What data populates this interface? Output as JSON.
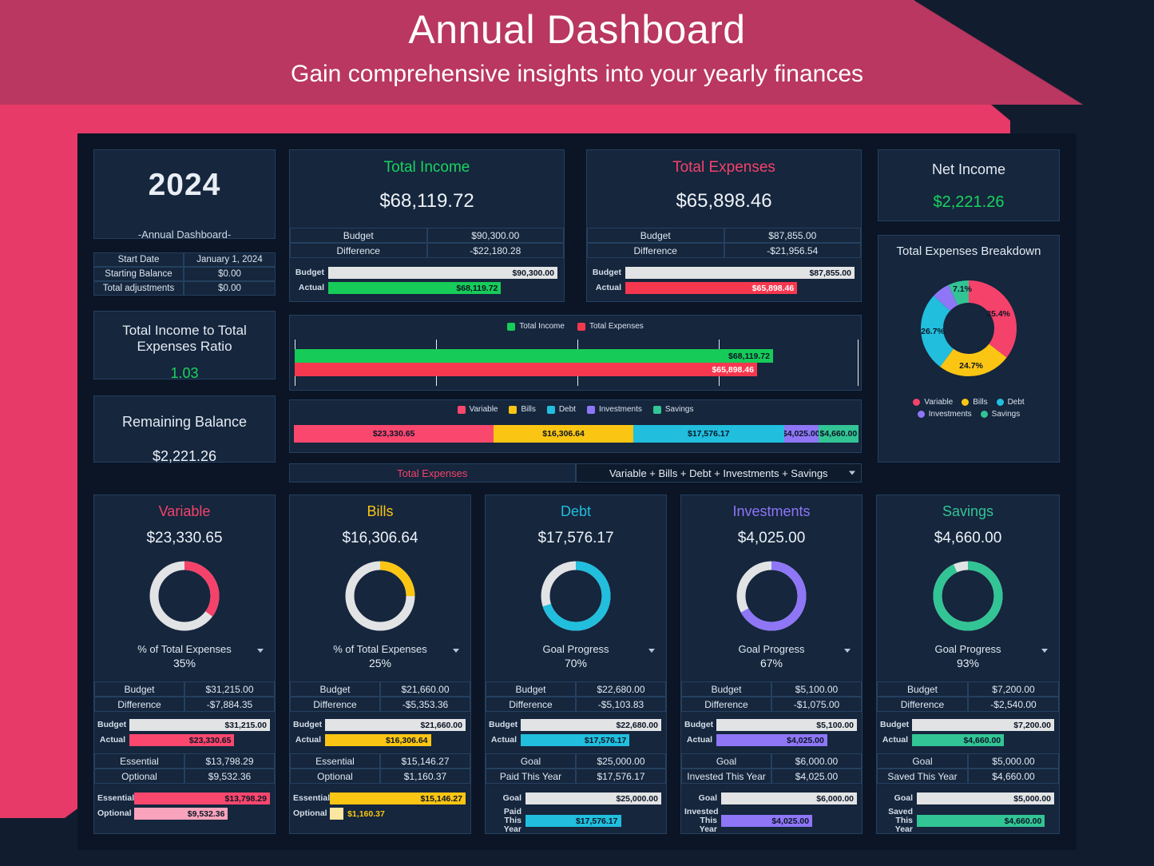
{
  "header": {
    "title": "Annual Dashboard",
    "subtitle": "Gain comprehensive insights into your yearly finances",
    "banner_color": "#b93760",
    "page_accent": "#e73a68"
  },
  "year_panel": {
    "year": "2024",
    "caption": "-Annual Dashboard-",
    "info_rows": [
      {
        "label": "Start Date",
        "value": "January 1, 2024"
      },
      {
        "label": "Starting Balance",
        "value": "$0.00"
      },
      {
        "label": "Total adjustments",
        "value": "$0.00"
      }
    ]
  },
  "ratio_panel": {
    "title_line1": "Total Income to Total",
    "title_line2": "Expenses Ratio",
    "value": "1.03",
    "value_color": "#19d45d"
  },
  "remaining_panel": {
    "title": "Remaining Balance",
    "value": "$2,221.26"
  },
  "total_income": {
    "title": "Total Income",
    "title_color": "#19d45d",
    "amount": "$68,119.72",
    "rows": [
      {
        "label": "Budget",
        "value": "$90,300.00",
        "color": "#e2e9f2"
      },
      {
        "label": "Difference",
        "value": "-$22,180.28",
        "color": "#f5426a"
      }
    ],
    "bars": [
      {
        "label": "Budget",
        "value": "$90,300.00",
        "pct": 100,
        "color": "#e2e3e5",
        "text_color": "#0b1525"
      },
      {
        "label": "Actual",
        "value": "$68,119.72",
        "pct": 75.4,
        "color": "#17cb58",
        "text_color": "#0b1525"
      }
    ]
  },
  "total_expenses": {
    "title": "Total Expenses",
    "title_color": "#f5426a",
    "amount": "$65,898.46",
    "rows": [
      {
        "label": "Budget",
        "value": "$87,855.00",
        "color": "#e2e9f2"
      },
      {
        "label": "Difference",
        "value": "-$21,956.54",
        "color": "#19d45d"
      }
    ],
    "bars": [
      {
        "label": "Budget",
        "value": "$87,855.00",
        "pct": 100,
        "color": "#e2e3e5",
        "text_color": "#0b1525"
      },
      {
        "label": "Actual",
        "value": "$65,898.46",
        "pct": 75.0,
        "color": "#f6384f",
        "text_color": "#ffffff"
      }
    ]
  },
  "net_income": {
    "title": "Net Income",
    "value": "$2,221.26",
    "value_color": "#19d45d"
  },
  "breakdown": {
    "title": "Total Expenses Breakdown",
    "labels": [
      {
        "name": "Variable",
        "color": "#f5426a"
      },
      {
        "name": "Bills",
        "color": "#fbc513"
      },
      {
        "name": "Debt",
        "color": "#21bedd"
      },
      {
        "name": "Investments",
        "color": "#8e76f7"
      },
      {
        "name": "Savings",
        "color": "#33c495"
      }
    ]
  },
  "chart_data": [
    {
      "type": "bar",
      "title": "",
      "orientation": "horizontal",
      "categories": [
        "Total Income",
        "Total Expenses"
      ],
      "values": [
        68119.72,
        65898.46
      ],
      "data_labels": [
        "$68,119.72",
        "$65,898.46"
      ],
      "colors": [
        "#17cb58",
        "#f6384f"
      ],
      "legend": [
        "Total Income",
        "Total Expenses"
      ],
      "legend_position": "top",
      "grid": true,
      "xlim": [
        0,
        80000
      ],
      "xlabel": "",
      "ylabel": ""
    },
    {
      "type": "bar",
      "title": "",
      "orientation": "stacked-horizontal",
      "categories": [
        "Variable",
        "Bills",
        "Debt",
        "Investments",
        "Savings"
      ],
      "values": [
        23330.65,
        16306.64,
        17576.17,
        4025.0,
        4660.0
      ],
      "data_labels": [
        "$23,330.65",
        "$16,306.64",
        "$17,576.17",
        "$4,025.00",
        "$4,660.00"
      ],
      "colors": [
        "#f9476e",
        "#fbc513",
        "#21bedd",
        "#8e76f7",
        "#33c495"
      ],
      "legend": [
        "Variable",
        "Bills",
        "Debt",
        "Investments",
        "Savings"
      ],
      "legend_position": "top",
      "grid": false
    },
    {
      "type": "pie",
      "title": "Total Expenses Breakdown",
      "labels": [
        "Variable",
        "Bills",
        "Debt",
        "Investments",
        "Savings"
      ],
      "values": [
        35.4,
        24.7,
        26.7,
        6.1,
        7.1
      ],
      "data_labels": [
        "35.4%",
        "24.7%",
        "26.7%",
        "",
        "7.1%"
      ],
      "colors": [
        "#f5426a",
        "#fbc513",
        "#21bedd",
        "#8e76f7",
        "#33c495"
      ],
      "legend_position": "bottom",
      "donut": true
    }
  ],
  "selector": {
    "left_label": "Total Expenses",
    "right_label": "Variable + Bills + Debt + Investments + Savings"
  },
  "categories": [
    {
      "key": "variable",
      "title": "Variable",
      "color": "#f5426a",
      "light_color": "#f9a4bc",
      "amount": "$23,330.65",
      "metric_label": "% of Total Expenses",
      "metric_value": "35%",
      "ring_pct": 35,
      "rows": [
        {
          "label": "Budget",
          "value": "$31,215.00",
          "color": "#e2e9f2"
        },
        {
          "label": "Difference",
          "value": "-$7,884.35",
          "color": "#19d45d"
        }
      ],
      "bars1": [
        {
          "label": "Budget",
          "value": "$31,215.00",
          "pct": 100,
          "color": "#e2e3e5",
          "text_color": "#0b1525"
        },
        {
          "label": "Actual",
          "value": "$23,330.65",
          "pct": 74.7,
          "color": "#f9476e",
          "text_color": "#0b1525"
        }
      ],
      "rows2": [
        {
          "label": "Essential",
          "value": "$13,798.29"
        },
        {
          "label": "Optional",
          "value": "$9,532.36"
        }
      ],
      "bars2": [
        {
          "label": "Essential",
          "value": "$13,798.29",
          "pct": 100,
          "color": "#f9476e",
          "text_color": "#0b1525"
        },
        {
          "label": "Optional",
          "value": "$9,532.36",
          "pct": 69.1,
          "color": "#f9a4bc",
          "text_color": "#0b1525"
        }
      ]
    },
    {
      "key": "bills",
      "title": "Bills",
      "color": "#fbc513",
      "light_color": "#fbe7a1",
      "amount": "$16,306.64",
      "metric_label": "% of Total Expenses",
      "metric_value": "25%",
      "ring_pct": 25,
      "rows": [
        {
          "label": "Budget",
          "value": "$21,660.00",
          "color": "#e2e9f2"
        },
        {
          "label": "Difference",
          "value": "-$5,353.36",
          "color": "#19d45d"
        }
      ],
      "bars1": [
        {
          "label": "Budget",
          "value": "$21,660.00",
          "pct": 100,
          "color": "#e2e3e5",
          "text_color": "#0b1525"
        },
        {
          "label": "Actual",
          "value": "$16,306.64",
          "pct": 75.3,
          "color": "#fbc513",
          "text_color": "#0b1525"
        }
      ],
      "rows2": [
        {
          "label": "Essential",
          "value": "$15,146.27"
        },
        {
          "label": "Optional",
          "value": "$1,160.37"
        }
      ],
      "bars2": [
        {
          "label": "Essential",
          "value": "$15,146.27",
          "pct": 100,
          "color": "#fbc513",
          "text_color": "#0b1525"
        },
        {
          "label": "Optional",
          "value": "$1,160.37",
          "pct": 7.7,
          "color": "#fbe7a1",
          "text_color": "#fbc513",
          "outside": true
        }
      ]
    },
    {
      "key": "debt",
      "title": "Debt",
      "color": "#21bedd",
      "light_color": "#21bedd",
      "amount": "$17,576.17",
      "metric_label": "Goal Progress",
      "metric_value": "70%",
      "ring_pct": 70,
      "rows": [
        {
          "label": "Budget",
          "value": "$22,680.00",
          "color": "#e2e9f2"
        },
        {
          "label": "Difference",
          "value": "-$5,103.83",
          "color": "#f5426a"
        }
      ],
      "bars1": [
        {
          "label": "Budget",
          "value": "$22,680.00",
          "pct": 100,
          "color": "#e2e3e5",
          "text_color": "#0b1525"
        },
        {
          "label": "Actual",
          "value": "$17,576.17",
          "pct": 77.5,
          "color": "#21bedd",
          "text_color": "#0b1525"
        }
      ],
      "rows2": [
        {
          "label": "Goal",
          "value": "$25,000.00"
        },
        {
          "label": "Paid This Year",
          "value": "$17,576.17"
        }
      ],
      "bars2": [
        {
          "label": "Goal",
          "value": "$25,000.00",
          "pct": 100,
          "color": "#e2e3e5",
          "text_color": "#0b1525"
        },
        {
          "label": "Paid This Year",
          "value": "$17,576.17",
          "pct": 70.3,
          "color": "#21bedd",
          "text_color": "#0b1525"
        }
      ]
    },
    {
      "key": "investments",
      "title": "Investments",
      "color": "#8e76f7",
      "light_color": "#8e76f7",
      "amount": "$4,025.00",
      "metric_label": "Goal Progress",
      "metric_value": "67%",
      "ring_pct": 67,
      "rows": [
        {
          "label": "Budget",
          "value": "$5,100.00",
          "color": "#e2e9f2"
        },
        {
          "label": "Difference",
          "value": "-$1,075.00",
          "color": "#f5426a"
        }
      ],
      "bars1": [
        {
          "label": "Budget",
          "value": "$5,100.00",
          "pct": 100,
          "color": "#e2e3e5",
          "text_color": "#0b1525"
        },
        {
          "label": "Actual",
          "value": "$4,025.00",
          "pct": 78.9,
          "color": "#8e76f7",
          "text_color": "#0b1525"
        }
      ],
      "rows2": [
        {
          "label": "Goal",
          "value": "$6,000.00"
        },
        {
          "label": "Invested This Year",
          "value": "$4,025.00"
        }
      ],
      "bars2": [
        {
          "label": "Goal",
          "value": "$6,000.00",
          "pct": 100,
          "color": "#e2e3e5",
          "text_color": "#0b1525"
        },
        {
          "label": "Invested This Year",
          "value": "$4,025.00",
          "pct": 67.1,
          "color": "#8e76f7",
          "text_color": "#0b1525"
        }
      ]
    },
    {
      "key": "savings",
      "title": "Savings",
      "color": "#33c495",
      "light_color": "#33c495",
      "amount": "$4,660.00",
      "metric_label": "Goal Progress",
      "metric_value": "93%",
      "ring_pct": 93,
      "rows": [
        {
          "label": "Budget",
          "value": "$7,200.00",
          "color": "#e2e9f2"
        },
        {
          "label": "Difference",
          "value": "-$2,540.00",
          "color": "#f5426a"
        }
      ],
      "bars1": [
        {
          "label": "Budget",
          "value": "$7,200.00",
          "pct": 100,
          "color": "#e2e3e5",
          "text_color": "#0b1525"
        },
        {
          "label": "Actual",
          "value": "$4,660.00",
          "pct": 64.7,
          "color": "#33c495",
          "text_color": "#0b1525"
        }
      ],
      "rows2": [
        {
          "label": "Goal",
          "value": "$5,000.00"
        },
        {
          "label": "Saved This Year",
          "value": "$4,660.00"
        }
      ],
      "bars2": [
        {
          "label": "Goal",
          "value": "$5,000.00",
          "pct": 100,
          "color": "#e2e3e5",
          "text_color": "#0b1525"
        },
        {
          "label": "Saved This Year",
          "value": "$4,660.00",
          "pct": 93.2,
          "color": "#33c495",
          "text_color": "#0b1525"
        }
      ]
    }
  ]
}
